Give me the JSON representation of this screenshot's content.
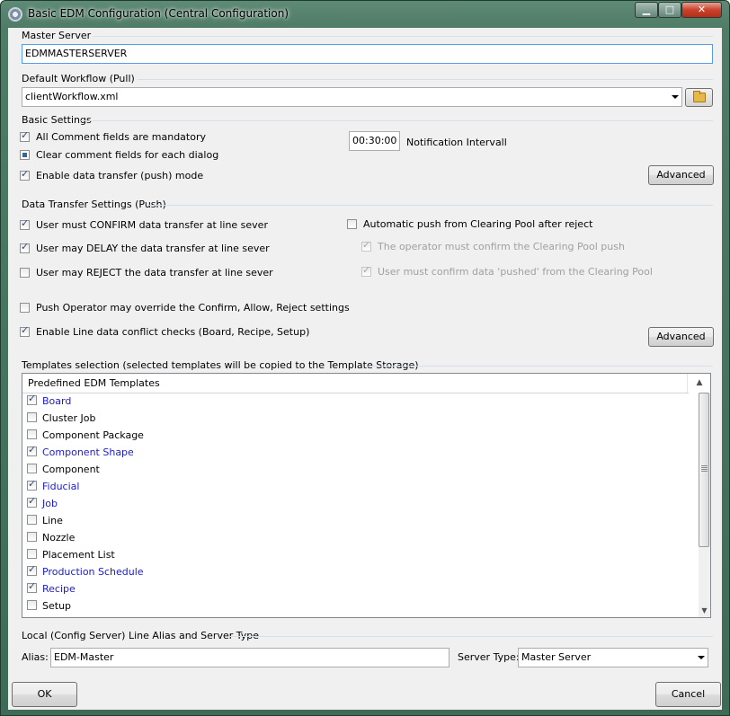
{
  "window": {
    "title": "Basic EDM Configuration (Central Configuration)",
    "min_glyph": "▁",
    "max_glyph": "□",
    "close_glyph": "✕"
  },
  "master_server": {
    "label": "Master Server",
    "value": "EDMMASTERSERVER"
  },
  "default_workflow": {
    "label": "Default Workflow (Pull)",
    "value": "clientWorkflow.xml"
  },
  "basic_settings": {
    "label": "Basic Settings",
    "mandatory_comments": {
      "label": "All Comment fields are mandatory",
      "checked": true
    },
    "clear_comments": {
      "label": "Clear comment fields for each dialog",
      "checked": "indeterminate"
    },
    "enable_push": {
      "label": "Enable data transfer (push) mode",
      "checked": true
    },
    "interval_value": "00:30:00",
    "interval_label": "Notification Intervall",
    "advanced_label": "Advanced"
  },
  "data_transfer": {
    "label": "Data Transfer Settings (Push)",
    "confirm": {
      "label": "User must CONFIRM data transfer at  line sever",
      "checked": true
    },
    "delay": {
      "label": "User may DELAY the data transfer at  line sever",
      "checked": true
    },
    "reject": {
      "label": "User may REJECT the data transfer at  line sever",
      "checked": false
    },
    "auto_push": {
      "label": "Automatic push from Clearing Pool after reject",
      "checked": false
    },
    "operator_confirm": {
      "label": "The operator must confirm the Clearing Pool push",
      "checked": true,
      "disabled": true
    },
    "user_confirm_pushed": {
      "label": "User must confirm data 'pushed' from the Clearing Pool",
      "checked": true,
      "disabled": true
    },
    "override": {
      "label": "Push Operator may override the Confirm, Allow, Reject settings",
      "checked": false
    },
    "conflict_checks": {
      "label": "Enable Line data conflict checks (Board, Recipe, Setup)",
      "checked": true
    },
    "advanced_label": "Advanced"
  },
  "templates": {
    "label": "Templates selection (selected templates will be copied to the Template Storage)",
    "column_header": "Predefined EDM Templates",
    "items": [
      {
        "label": "Board",
        "checked": true
      },
      {
        "label": "Cluster Job",
        "checked": false
      },
      {
        "label": "Component Package",
        "checked": false
      },
      {
        "label": "Component Shape",
        "checked": true
      },
      {
        "label": "Component",
        "checked": false
      },
      {
        "label": "Fiducial",
        "checked": true
      },
      {
        "label": "Job",
        "checked": true
      },
      {
        "label": "Line",
        "checked": false
      },
      {
        "label": "Nozzle",
        "checked": false
      },
      {
        "label": "Placement List",
        "checked": false
      },
      {
        "label": "Production Schedule",
        "checked": true
      },
      {
        "label": "Recipe",
        "checked": true
      },
      {
        "label": "Setup",
        "checked": false
      }
    ]
  },
  "local": {
    "label": "Local (Config Server) Line Alias and Server Type",
    "alias_label": "Alias:",
    "alias_value": "EDM-Master",
    "server_type_label": "Server Type:",
    "server_type_value": "Master Server"
  },
  "footer": {
    "ok_label": "OK",
    "cancel_label": "Cancel"
  },
  "colors": {
    "selected_item_text": "#1c1cc4",
    "frame_green": "#4f7c67",
    "dialog_bg": "#f0f0f0"
  }
}
